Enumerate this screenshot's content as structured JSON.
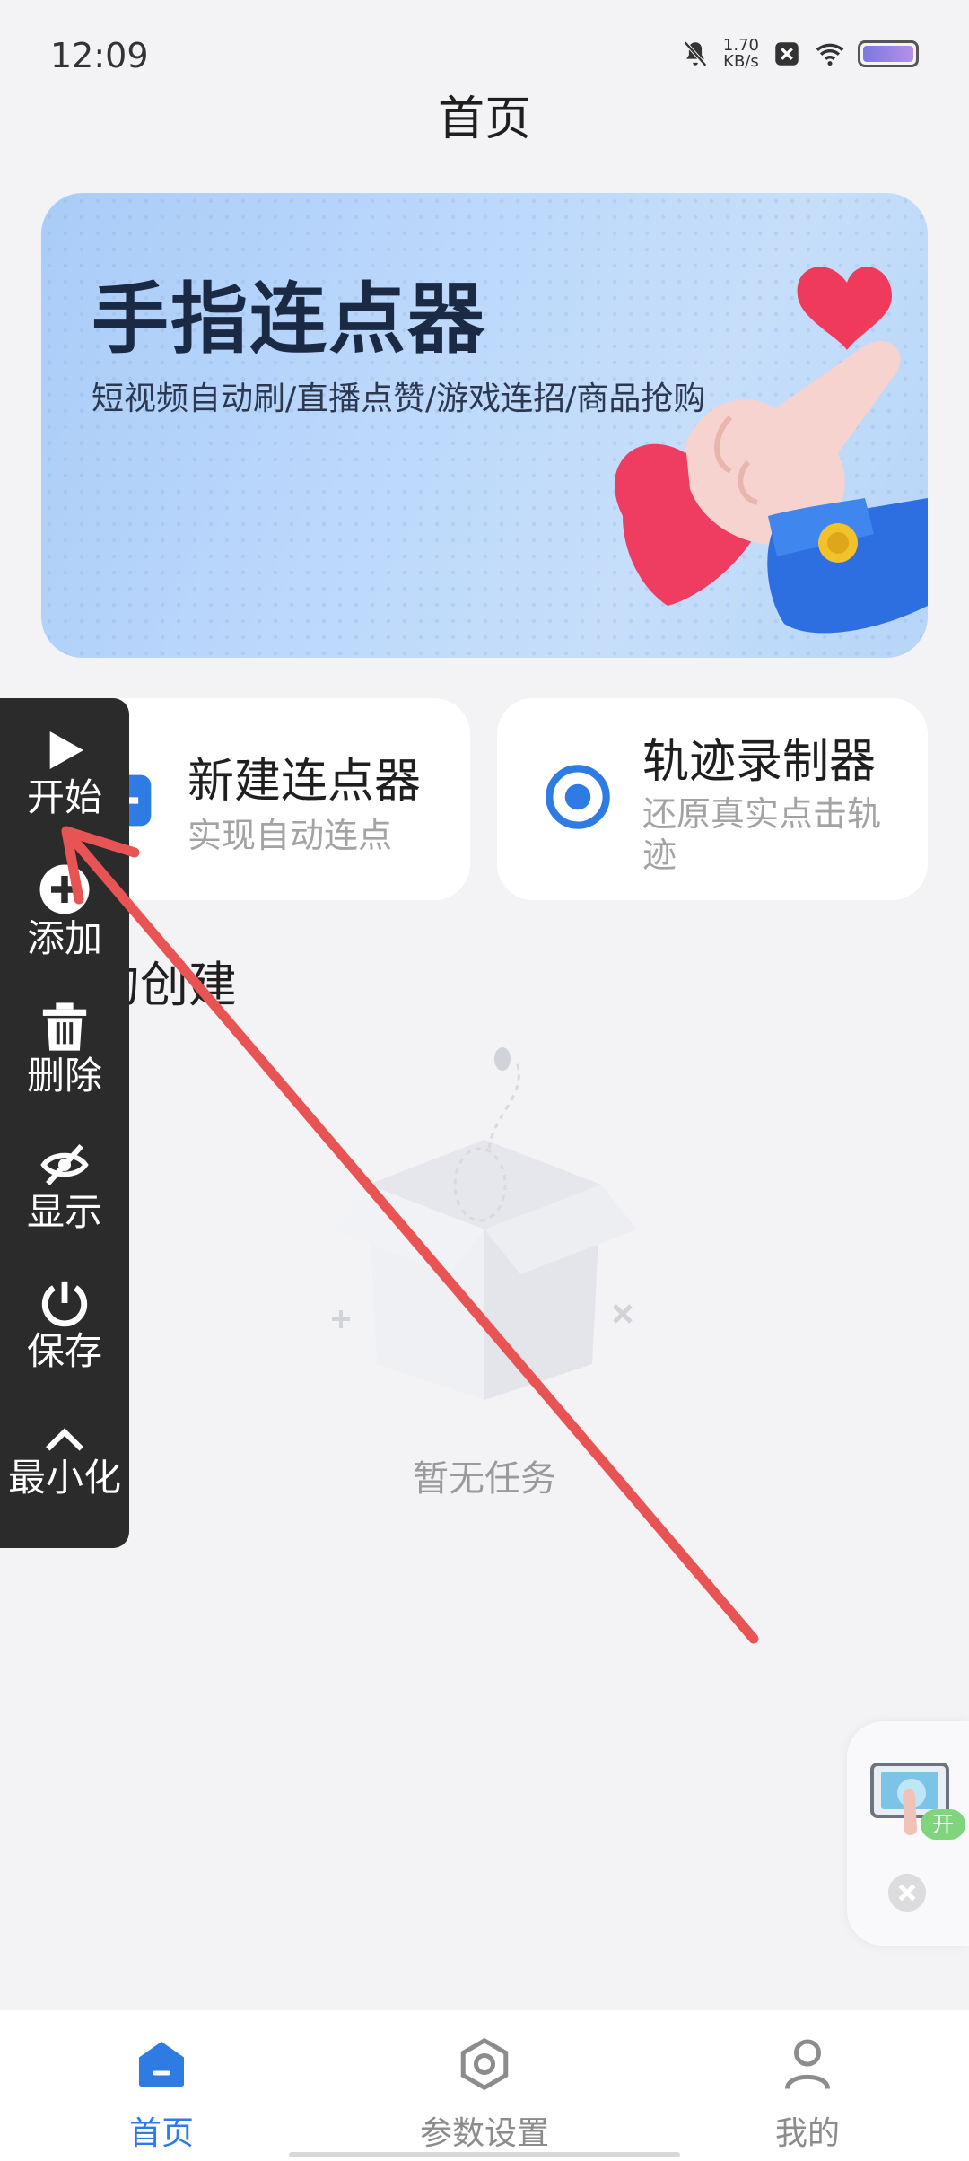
{
  "status_bar": {
    "time": "12:09",
    "net_speed_value": "1.70",
    "net_speed_unit": "KB/s",
    "icons": [
      "bell-muted-icon",
      "close-box-icon",
      "wifi-icon",
      "battery-icon"
    ]
  },
  "header": {
    "title": "首页"
  },
  "banner": {
    "title": "手指连点器",
    "subtitle": "短视频自动刷/直播点赞/游戏连招/商品抢购"
  },
  "cards": [
    {
      "title": "新建连点器",
      "subtitle": "实现自动连点",
      "icon": "add-square-icon"
    },
    {
      "title": "轨迹录制器",
      "subtitle": "还原真实点击轨迹",
      "icon": "record-target-icon"
    }
  ],
  "section": {
    "title": "我的创建"
  },
  "empty": {
    "text": "暂无任务"
  },
  "float_toolbar": {
    "items": [
      {
        "label": "开始",
        "icon": "play-icon"
      },
      {
        "label": "添加",
        "icon": "plus-circle-icon"
      },
      {
        "label": "删除",
        "icon": "trash-icon"
      },
      {
        "label": "显示",
        "icon": "eye-off-icon"
      },
      {
        "label": "保存",
        "icon": "power-icon"
      },
      {
        "label": "最小化",
        "icon": "chevron-up-icon"
      }
    ]
  },
  "widget": {
    "badge": "开"
  },
  "bottom_nav": {
    "items": [
      {
        "label": "首页",
        "icon": "home-icon",
        "active": true
      },
      {
        "label": "参数设置",
        "icon": "hexagon-settings-icon",
        "active": false
      },
      {
        "label": "我的",
        "icon": "person-icon",
        "active": false
      }
    ]
  },
  "colors": {
    "accent": "#2f7be4",
    "toolbar_bg": "#2b2b2b",
    "arrow": "#e85454",
    "page_bg": "#f3f3f6"
  }
}
